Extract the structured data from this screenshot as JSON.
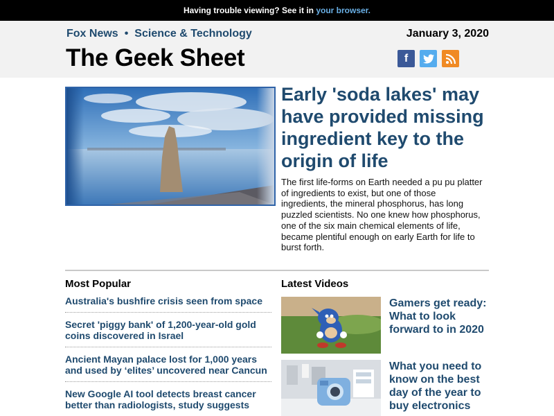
{
  "topbar": {
    "text": "Having trouble viewing? See it in ",
    "link": "your browser."
  },
  "header": {
    "nav_fox": "Fox News",
    "nav_sep": "•",
    "nav_section": "Science & Technology",
    "date": "January 3, 2020",
    "brand": "The Geek Sheet",
    "social": [
      {
        "name": "facebook",
        "glyph": "f"
      },
      {
        "name": "twitter",
        "glyph": "t"
      },
      {
        "name": "rss",
        "glyph": ")"
      }
    ]
  },
  "hero": {
    "title": "Early 'soda lakes' may have provided missing ingredient key to the origin of life",
    "body": "The first life-forms on Earth needed a pu pu platter of ingredients to exist, but one of those ingredients, the mineral phosphorus, has long puzzled scientists. No one knew how phosphorus, one of the six main chemical elements of life, became plentiful enough on early Earth for life to burst forth."
  },
  "most_popular": {
    "heading": "Most Popular",
    "items": [
      "Australia's bushfire crisis seen from space",
      "Secret 'piggy bank' of 1,200-year-old gold coins discovered in Israel",
      "Ancient Mayan palace lost for 1,000 years and used by ‘elites’ uncovered near Cancun",
      "New Google AI tool detects breast cancer better than radiologists, study suggests"
    ]
  },
  "latest_videos": {
    "heading": "Latest Videos",
    "items": [
      {
        "title": "Gamers get ready: What to look forward to in 2020"
      },
      {
        "title": "What you need to know on the best day of the year to buy electronics"
      }
    ]
  }
}
